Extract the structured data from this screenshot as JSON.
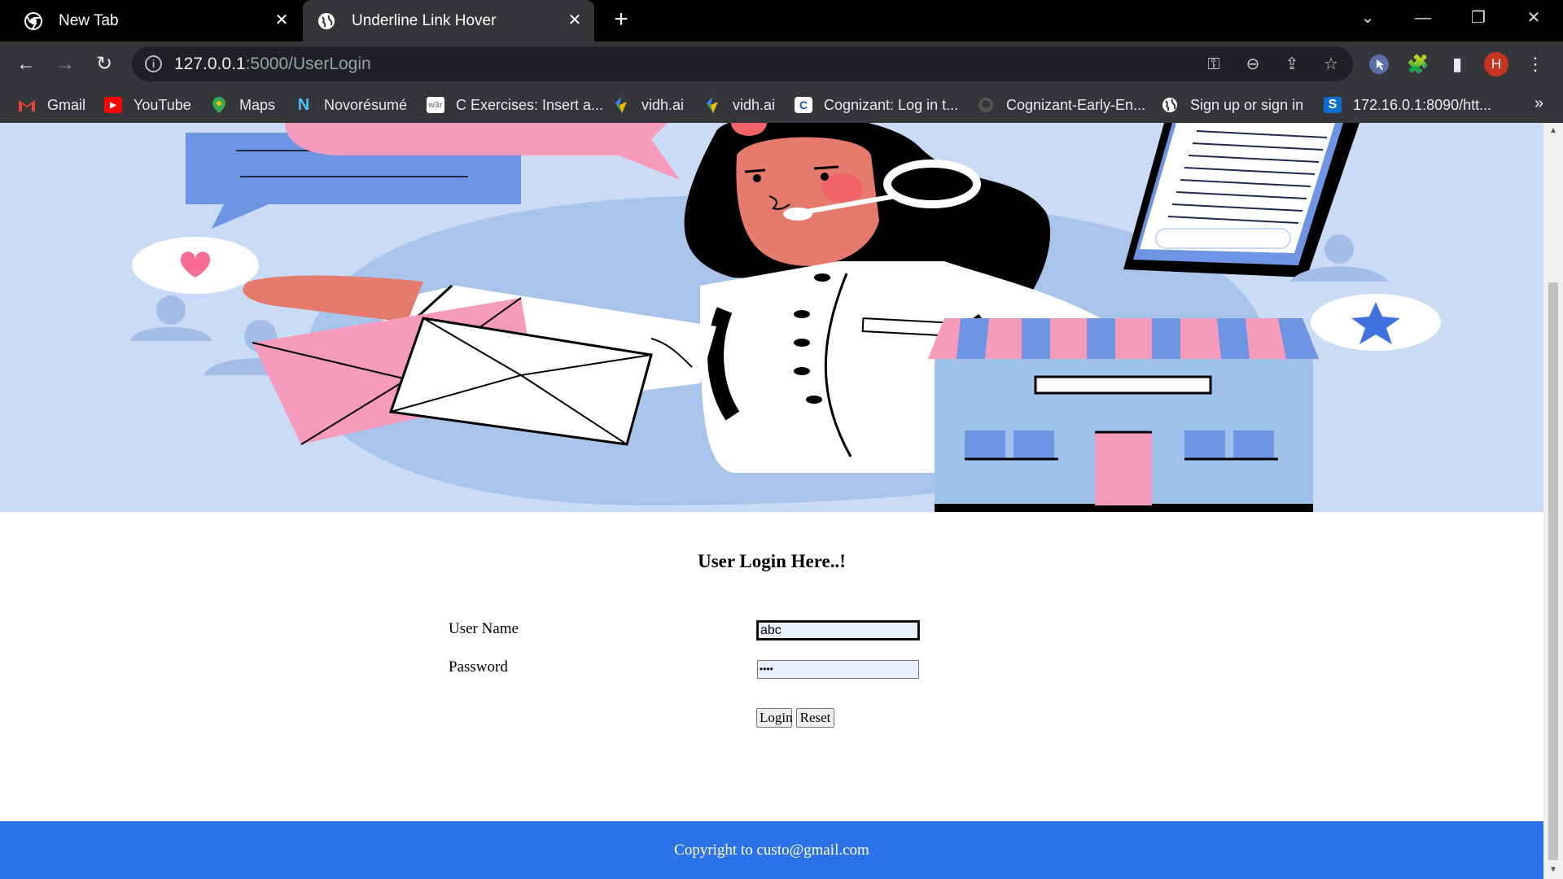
{
  "browser": {
    "tabs": [
      {
        "title": "New Tab",
        "active": false
      },
      {
        "title": "Underline Link Hover",
        "active": true
      }
    ],
    "url_host": "127.0.0.1",
    "url_rest": ":5000/UserLogin",
    "profile_initial": "H",
    "bookmarks": [
      {
        "label": "Gmail",
        "icon": "gmail-icon"
      },
      {
        "label": "YouTube",
        "icon": "youtube-icon"
      },
      {
        "label": "Maps",
        "icon": "maps-icon"
      },
      {
        "label": "Novorésumé",
        "icon": "novoresume-icon"
      },
      {
        "label": "C Exercises: Insert a...",
        "icon": "w3r-icon"
      },
      {
        "label": "vidh.ai",
        "icon": "vidhai-icon"
      },
      {
        "label": "vidh.ai",
        "icon": "vidhai-icon"
      },
      {
        "label": "Cognizant: Log in t...",
        "icon": "cognizant-icon"
      },
      {
        "label": "Cognizant-Early-En...",
        "icon": "github-icon"
      },
      {
        "label": "Sign up or sign in",
        "icon": "globe-icon"
      },
      {
        "label": "172.16.0.1:8090/htt...",
        "icon": "sophos-icon"
      }
    ],
    "w3r_badge": "w3r",
    "sophos_badge": "S"
  },
  "page": {
    "login_title": "User Login Here..!",
    "username_label": "User Name",
    "password_label": "Password",
    "username_value": "abc",
    "password_value": "••••",
    "login_button": "Login",
    "reset_button": "Reset",
    "footer_text": "Copyright to custo@gmail.com"
  },
  "colors": {
    "hero_bg": "#cadcf5",
    "footer_bg": "#2b72e8",
    "tab_active": "#35363a",
    "tab_strip": "#000000"
  }
}
